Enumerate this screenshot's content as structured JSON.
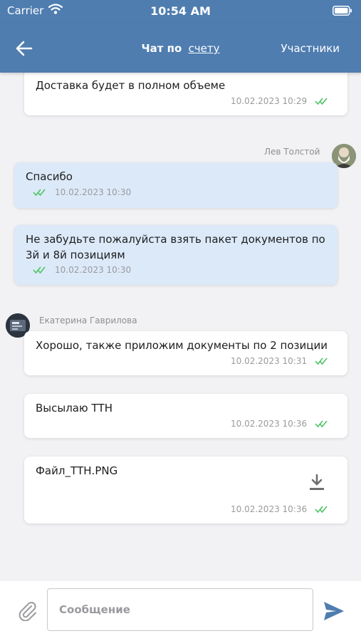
{
  "status_bar": {
    "carrier": "Carrier",
    "time": "10:54 AM"
  },
  "header": {
    "title_prefix": "Чат по",
    "title_link": "счету",
    "participants_label": "Участники"
  },
  "messages": [
    {
      "text": "Доставка будет в полном объеме",
      "time": "10.02.2023 10:29",
      "status": "read"
    },
    {
      "author": "Лев Толстой",
      "text": "Спасибо",
      "time": "10.02.2023 10:30",
      "status": "read"
    },
    {
      "text_line1": "Не забудьте пожалуйста взять пакет документов по",
      "text_line2": "3й и 8й позициям",
      "time": "10.02.2023 10:30",
      "status": "read"
    },
    {
      "author": "Екатерина Гаврилова",
      "text": "Хорошо, также приложим документы по 2 позиции",
      "time": "10.02.2023 10:31",
      "status": "read"
    },
    {
      "text": "Высылаю ТТН",
      "time": "10.02.2023 10:36",
      "status": "read"
    },
    {
      "file_name": "Файл_ТТН.PNG",
      "time": "10.02.2023 10:36",
      "status": "read"
    }
  ],
  "composer": {
    "placeholder": "Сообщение"
  },
  "colors": {
    "accent": "#4f7db0",
    "read_check": "#4cc462",
    "outgoing_bubble": "#dce9f8",
    "send_icon": "#4f7db0"
  }
}
